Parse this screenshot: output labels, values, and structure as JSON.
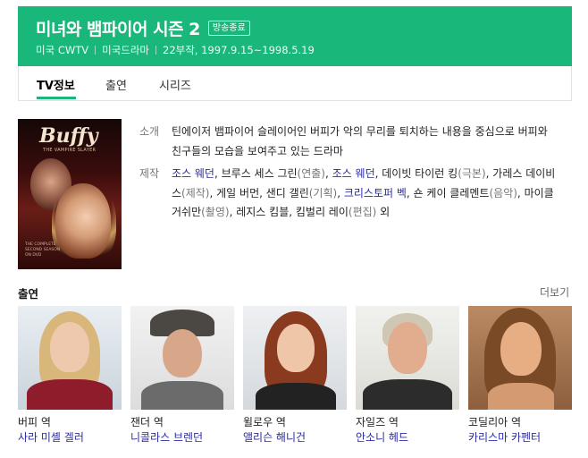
{
  "header": {
    "title": "미녀와 뱀파이어 시즌 2",
    "badge": "방송종료",
    "meta": [
      "미국 CWTV",
      "미국드라마",
      "22부작, 1997.9.15~1998.5.19"
    ]
  },
  "tabs": [
    "TV정보",
    "출연",
    "시리즈"
  ],
  "poster": {
    "logo": "Buffy",
    "subtitle": "THE VAMPIRE SLAYER",
    "caption_lines": [
      "THE COMPLETE",
      "SECOND SEASON",
      "ON DVD"
    ]
  },
  "info": {
    "summary_label": "소개",
    "summary": "틴에이저 뱀파이어 슬레이어인 버피가 악의 무리를 퇴치하는 내용을 중심으로 버피와 친구들의 모습을 보여주고 있는 드라마",
    "production_label": "제작",
    "credits": [
      {
        "name": "조스 웨던",
        "linked": true,
        "sep": ", "
      },
      {
        "name": "브루스 세스 그린",
        "linked": false,
        "role": "(연출)",
        "sep": ", "
      },
      {
        "name": "조스 웨던",
        "linked": true,
        "sep": ", "
      },
      {
        "name": "데이빗 타이런 킹",
        "linked": false,
        "role": "(극본)",
        "sep": ", "
      },
      {
        "name": "가레스 데이비스",
        "linked": false,
        "role": "(제작)",
        "sep": ", "
      },
      {
        "name": "게일 버먼",
        "linked": false,
        "sep": ", "
      },
      {
        "name": "샌디 갤린",
        "linked": false,
        "role": "(기획)",
        "sep": ", "
      },
      {
        "name": "크리스토퍼 벡",
        "linked": true,
        "sep": ", "
      },
      {
        "name": "숀 케이 클레멘트",
        "linked": false,
        "role": "(음악)",
        "sep": ", "
      },
      {
        "name": "마이클 거쉬만",
        "linked": false,
        "role": "(촬영)",
        "sep": ", "
      },
      {
        "name": "레지스 킴블",
        "linked": false,
        "sep": ", "
      },
      {
        "name": "킴벌리 레이",
        "linked": false,
        "role": "(편집)",
        "sep": " "
      },
      {
        "name": "외",
        "linked": false,
        "sep": ""
      }
    ]
  },
  "cast_section": {
    "heading": "출연",
    "more": "더보기",
    "cast": [
      {
        "role": "버피 역",
        "name": "사라 미셸 겔러"
      },
      {
        "role": "잰더 역",
        "name": "니콜라스 브렌던"
      },
      {
        "role": "윌로우 역",
        "name": "앨리슨 해니건"
      },
      {
        "role": "자일즈 역",
        "name": "안소니 헤드"
      },
      {
        "role": "코딜리아 역",
        "name": "카리스마 카펜터"
      }
    ]
  },
  "colors": {
    "accent": "#19b87a",
    "link": "#2a2a9e",
    "muted": "#777777"
  }
}
